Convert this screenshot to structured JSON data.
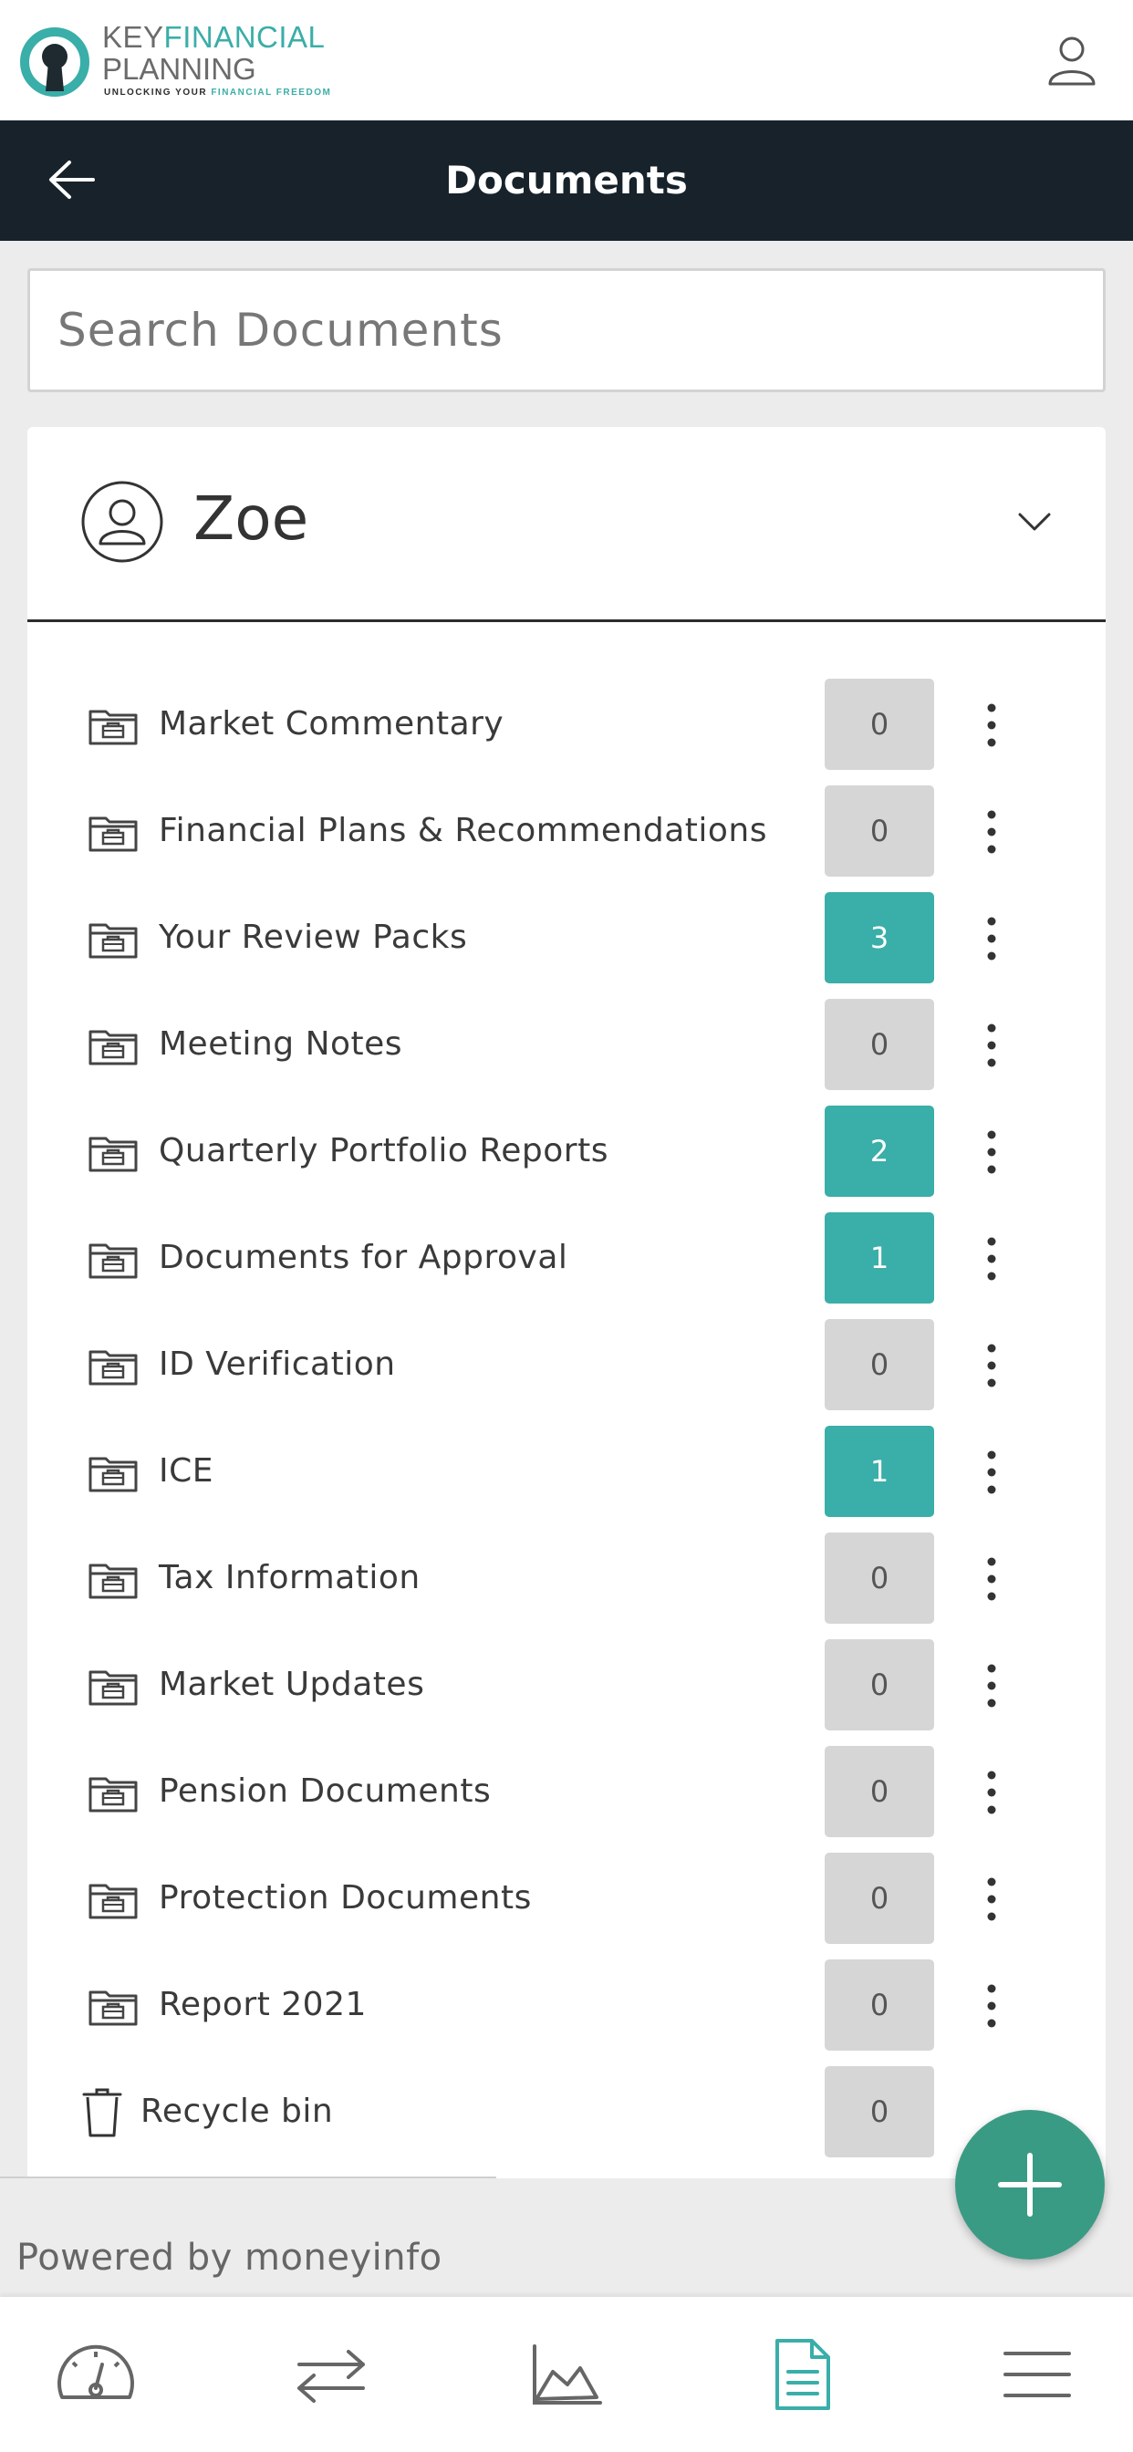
{
  "brand": {
    "key": "KEY",
    "financial": "FINANCIAL",
    "planning": "PLANNING",
    "tagline_prefix": "UNLOCKING YOUR ",
    "tagline_highlight": "FINANCIAL FREEDOM",
    "accent_color": "#3aaea8"
  },
  "header": {
    "title": "Documents",
    "background_color": "#17222a"
  },
  "search": {
    "placeholder": "Search Documents",
    "value": ""
  },
  "client": {
    "name": "Zoe"
  },
  "folders": [
    {
      "label": "Market Commentary",
      "count": "0",
      "icon": "folder-icon"
    },
    {
      "label": "Financial Plans & Recommendations",
      "count": "0",
      "icon": "folder-icon"
    },
    {
      "label": "Your Review Packs",
      "count": "3",
      "icon": "folder-icon"
    },
    {
      "label": "Meeting Notes",
      "count": "0",
      "icon": "folder-icon"
    },
    {
      "label": "Quarterly Portfolio Reports",
      "count": "2",
      "icon": "folder-icon"
    },
    {
      "label": "Documents for Approval",
      "count": "1",
      "icon": "folder-icon"
    },
    {
      "label": "ID Verification",
      "count": "0",
      "icon": "folder-icon"
    },
    {
      "label": "ICE",
      "count": "1",
      "icon": "folder-icon"
    },
    {
      "label": "Tax Information",
      "count": "0",
      "icon": "folder-icon"
    },
    {
      "label": "Market Updates",
      "count": "0",
      "icon": "folder-icon"
    },
    {
      "label": "Pension Documents",
      "count": "0",
      "icon": "folder-icon"
    },
    {
      "label": "Protection Documents",
      "count": "0",
      "icon": "folder-icon"
    },
    {
      "label": "Report 2021",
      "count": "0",
      "icon": "folder-icon"
    }
  ],
  "recycle_bin": {
    "label": "Recycle bin",
    "count": "0",
    "icon": "trash-icon"
  },
  "footer": {
    "powered_by": "Powered by moneyinfo"
  },
  "fab": {
    "icon": "plus-icon",
    "color": "#3a9b84"
  },
  "bottom_nav": {
    "items": [
      {
        "icon": "dashboard-gauge-icon",
        "active": false
      },
      {
        "icon": "transfer-arrows-icon",
        "active": false
      },
      {
        "icon": "area-chart-icon",
        "active": false
      },
      {
        "icon": "document-icon",
        "active": true
      },
      {
        "icon": "menu-icon",
        "active": false
      }
    ],
    "active_color": "#3aaea8",
    "inactive_color": "#666666"
  }
}
